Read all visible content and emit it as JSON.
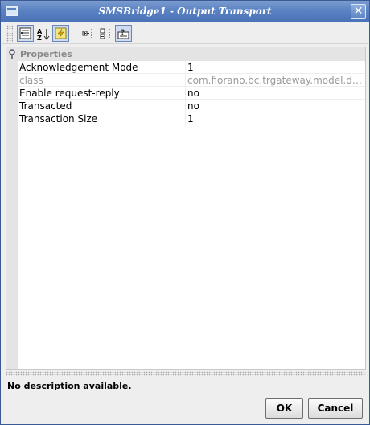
{
  "window": {
    "title": "SMSBridge1 - Output Transport",
    "close_glyph": "✕"
  },
  "toolbar": {
    "buttons": [
      {
        "icon": "categorized-view-icon",
        "active": true
      },
      {
        "icon": "sort-alphabetical-icon",
        "active": false
      },
      {
        "icon": "show-expert-icon",
        "active": true
      },
      {
        "icon": "expand-all-icon",
        "active": false
      },
      {
        "icon": "collapse-all-icon",
        "active": false
      },
      {
        "icon": "show-description-icon",
        "active": true
      }
    ]
  },
  "properties": {
    "category": "Properties",
    "rows": [
      {
        "name": "Acknowledgement Mode",
        "value": "1",
        "disabled": false
      },
      {
        "name": "class",
        "value": "com.fiorano.bc.trgateway.model.dm...",
        "disabled": true
      },
      {
        "name": "Enable request-reply",
        "value": "no",
        "disabled": false
      },
      {
        "name": "Transacted",
        "value": "no",
        "disabled": false
      },
      {
        "name": "Transaction Size",
        "value": "1",
        "disabled": false
      }
    ]
  },
  "description": "No description available.",
  "buttons": {
    "ok": "OK",
    "cancel": "Cancel"
  },
  "colors": {
    "titlebar": "#5b82c2",
    "selection": "#cfdcf0",
    "disabled_text": "#9a9a9a"
  }
}
